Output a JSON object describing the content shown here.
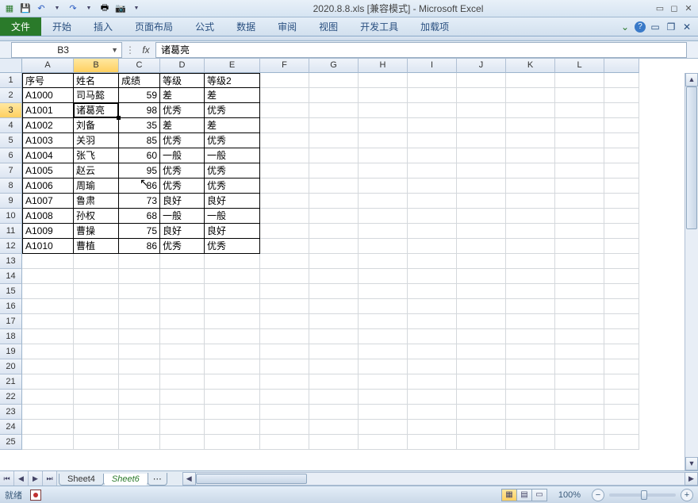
{
  "title": "2020.8.8.xls  [兼容模式] - Microsoft Excel",
  "ribbon": {
    "file": "文件",
    "tabs": [
      "开始",
      "插入",
      "页面布局",
      "公式",
      "数据",
      "审阅",
      "视图",
      "开发工具",
      "加载项"
    ]
  },
  "namebox": "B3",
  "fx_label": "fx",
  "formula_value": "诸葛亮",
  "columns": [
    "A",
    "B",
    "C",
    "D",
    "E",
    "F",
    "G",
    "H",
    "I",
    "J",
    "K",
    "L",
    ""
  ],
  "row_count": 25,
  "selected_cell": {
    "row": 3,
    "col": "B"
  },
  "table": {
    "header": [
      "序号",
      "姓名",
      "成绩",
      "等级",
      "等级2"
    ],
    "rows": [
      {
        "id": "A1000",
        "name": "司马懿",
        "score": 59,
        "grade": "差",
        "grade2": "差"
      },
      {
        "id": "A1001",
        "name": "诸葛亮",
        "score": 98,
        "grade": "优秀",
        "grade2": "优秀"
      },
      {
        "id": "A1002",
        "name": "刘备",
        "score": 35,
        "grade": "差",
        "grade2": "差"
      },
      {
        "id": "A1003",
        "name": "关羽",
        "score": 85,
        "grade": "优秀",
        "grade2": "优秀"
      },
      {
        "id": "A1004",
        "name": "张飞",
        "score": 60,
        "grade": "一般",
        "grade2": "一般"
      },
      {
        "id": "A1005",
        "name": "赵云",
        "score": 95,
        "grade": "优秀",
        "grade2": "优秀"
      },
      {
        "id": "A1006",
        "name": "周瑜",
        "score": 86,
        "grade": "优秀",
        "grade2": "优秀"
      },
      {
        "id": "A1007",
        "name": "鲁肃",
        "score": 73,
        "grade": "良好",
        "grade2": "良好"
      },
      {
        "id": "A1008",
        "name": "孙权",
        "score": 68,
        "grade": "一般",
        "grade2": "一般"
      },
      {
        "id": "A1009",
        "name": "曹操",
        "score": 75,
        "grade": "良好",
        "grade2": "良好"
      },
      {
        "id": "A1010",
        "name": "曹植",
        "score": 86,
        "grade": "优秀",
        "grade2": "优秀"
      }
    ]
  },
  "sheets": {
    "list": [
      "Sheet4",
      "Sheet6"
    ],
    "active": "Sheet6",
    "more": "⋯"
  },
  "status": {
    "ready": "就绪",
    "zoom": "100%"
  }
}
